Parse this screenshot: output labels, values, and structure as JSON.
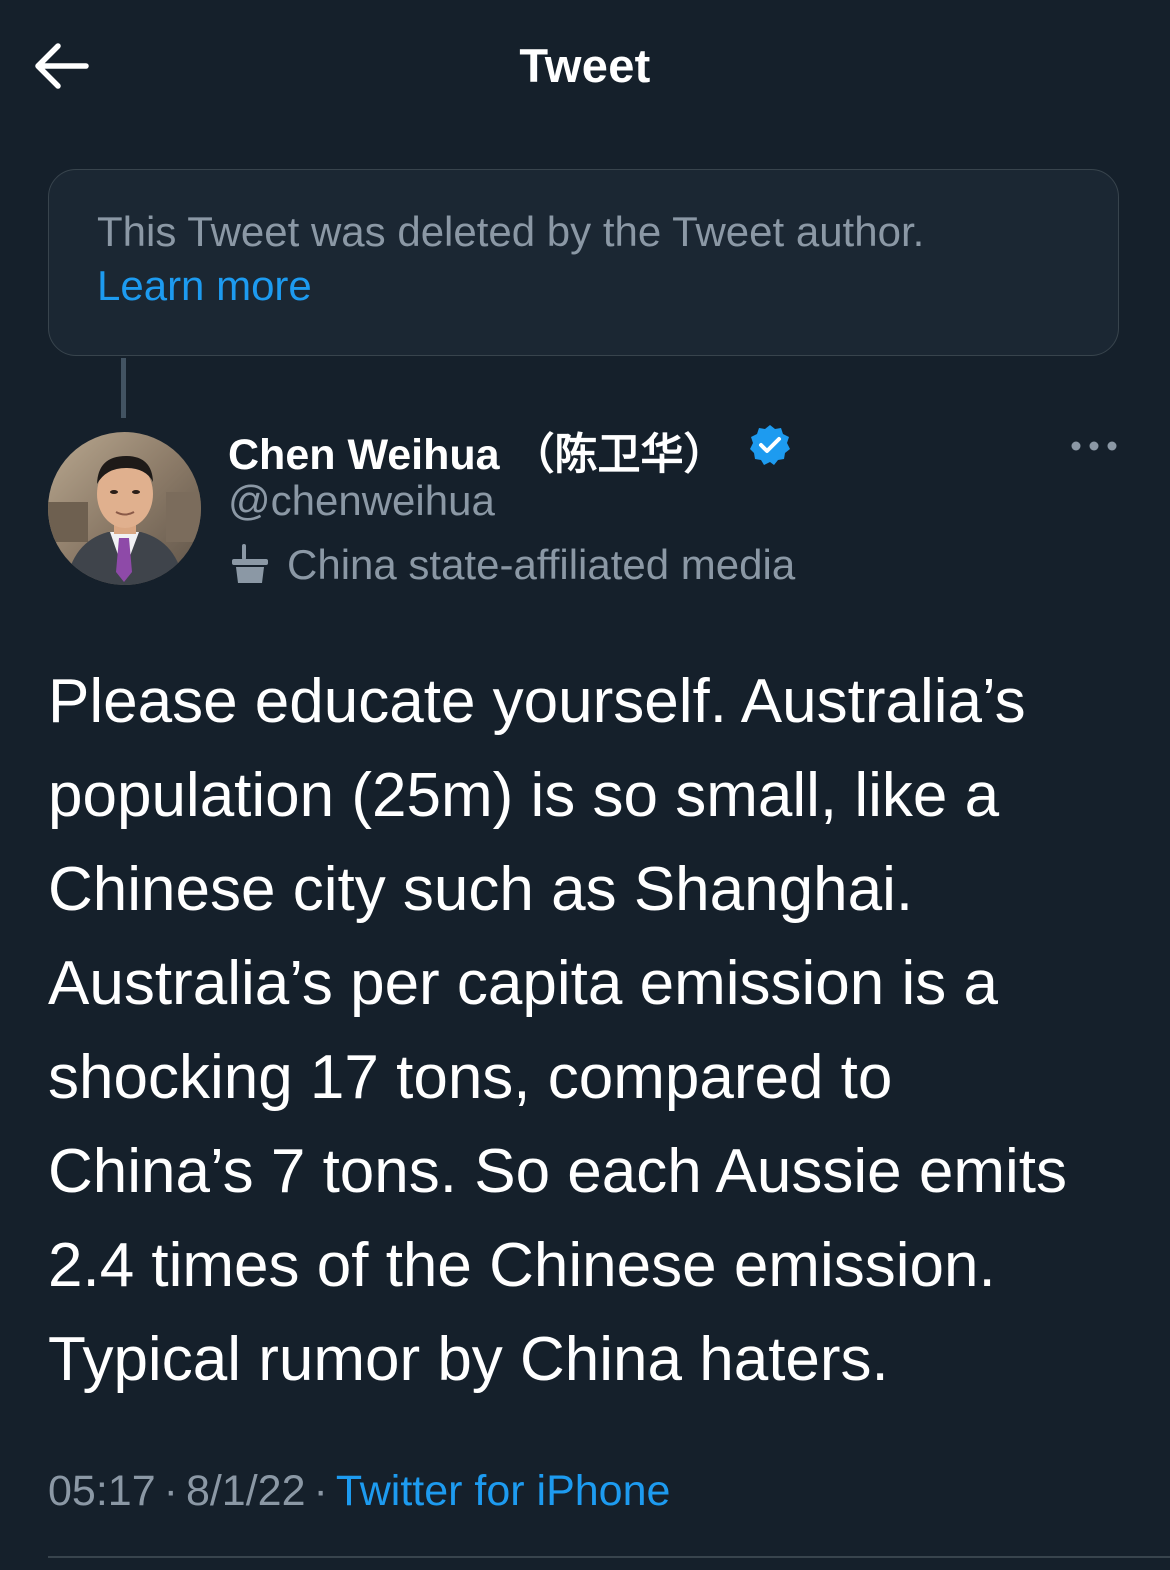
{
  "header": {
    "title": "Tweet",
    "back_icon": "arrow-left-icon"
  },
  "deleted_notice": {
    "text": "This Tweet was deleted by the Tweet author.",
    "link": "Learn more"
  },
  "author": {
    "name": "Chen Weihua （陈卫华）",
    "handle": "@chenweihua",
    "verified": true,
    "label": "China state-affiliated media",
    "label_icon": "podium-icon",
    "avatar_icon": "avatar-photo"
  },
  "tweet": {
    "lines": [
      "Please educate yourself. Australia’s",
      "population (25m) is so small, like a",
      "Chinese city such as Shanghai.",
      "Australia’s per capita emission is a",
      "shocking 17 tons, compared to",
      "China’s 7 tons. So each Aussie emits",
      "2.4 times of the Chinese emission.",
      "Typical rumor by China haters."
    ]
  },
  "meta": {
    "time": "05:17",
    "date": "8/1/22",
    "separator": "·",
    "source": "Twitter for iPhone"
  },
  "colors": {
    "background": "#15202b",
    "accent": "#1d9bf0",
    "secondary_text": "#8b98a5",
    "border": "#38444d"
  }
}
